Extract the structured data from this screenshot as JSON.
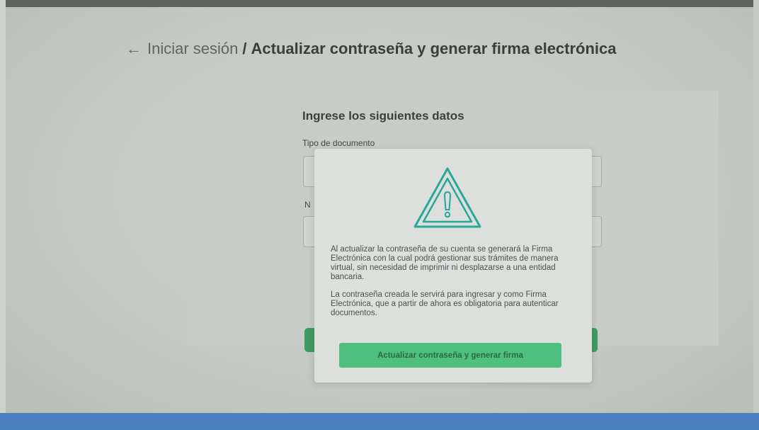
{
  "breadcrumb": {
    "back_arrow": "←",
    "back_label": "Iniciar sesión",
    "separator": "/",
    "current": "Actualizar contraseña y generar firma electrónica"
  },
  "form": {
    "title": "Ingrese los siguientes datos",
    "document_type_label": "Tipo de documento",
    "number_label_partial": "N"
  },
  "modal": {
    "icon": "warning-triangle-icon",
    "message_1": "Al actualizar la contraseña de su cuenta se generará la Firma Electrónica con la cual podrá gestionar sus trámites de manera virtual, sin necesidad de imprimir ni desplazarse a una entidad bancaria.",
    "message_2": "La contraseña creada le servirá para ingresar y como Firma Electrónica, que a partir de ahora es obligatoria para autenticar documentos.",
    "button_label": "Actualizar contraseña y generar firma"
  },
  "colors": {
    "accent_green": "#4fbf7d",
    "icon_teal": "#2aa69a",
    "footer_blue": "#4c7fc2"
  }
}
